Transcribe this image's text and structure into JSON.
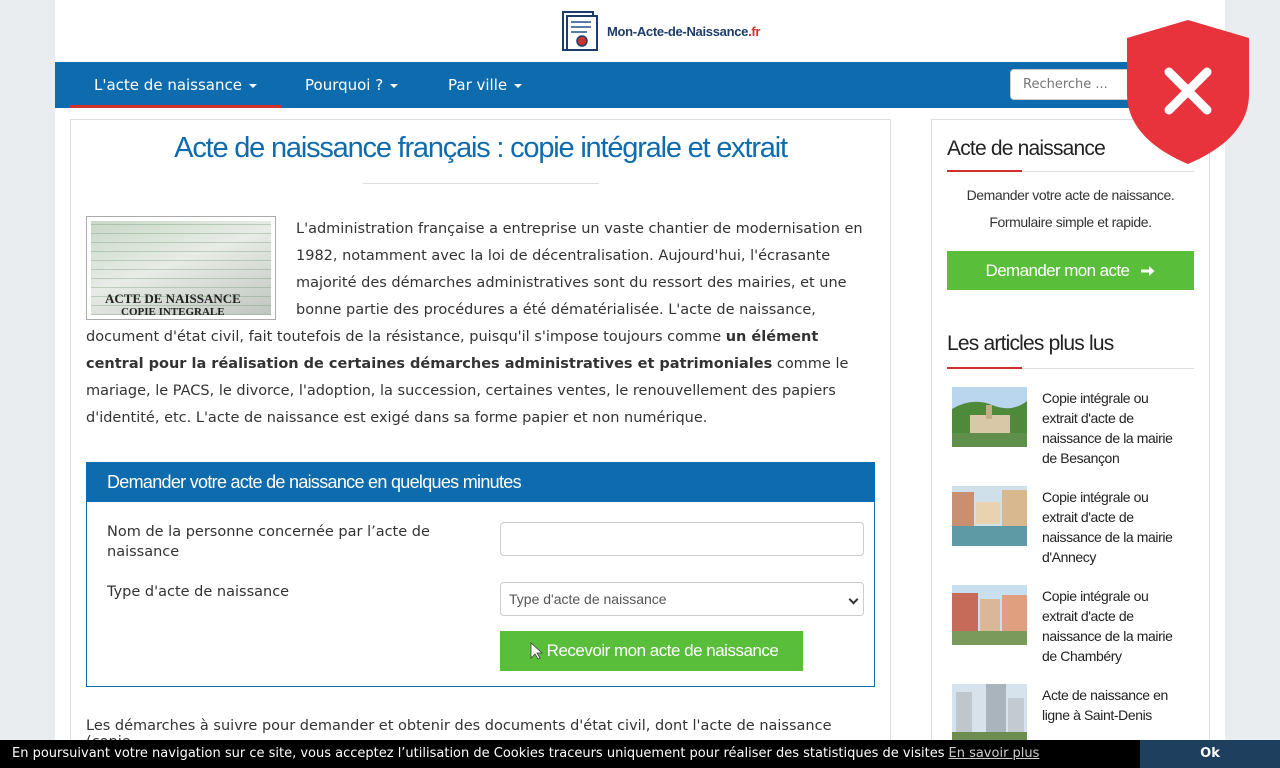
{
  "header": {
    "logo_text": "Mon-Acte-de-Naissance",
    "logo_tld": ".fr"
  },
  "nav": {
    "items": [
      {
        "label": "L'acte de naissance"
      },
      {
        "label": "Pourquoi ?"
      },
      {
        "label": "Par ville"
      }
    ],
    "search_placeholder": "Recherche ..."
  },
  "main": {
    "title": "Acte de naissance français : copie intégrale et extrait",
    "thumb_text_1": "ACTE DE NAISSANCE",
    "thumb_text_2": "COPIE INTEGRALE",
    "para_part1": "L'administration française a entreprise un vaste chantier de modernisation en 1982, notamment avec la loi de décentralisation. Aujourd'hui, l'écrasante majorité des démarches administratives sont du ressort des mairies, et une bonne partie des procédures a été dématérialisée. L'acte de naissance, document d'état civil, fait toutefois de la résistance, puisqu'il s'impose toujours comme ",
    "para_bold": "un élément central pour la réalisation de certaines démarches administratives et patrimoniales",
    "para_part2": " comme le mariage, le PACS, le divorce, l'adoption, la succession, certaines ventes, le renouvellement des papiers d'identité, etc. L'acte de naissance est exigé dans sa forme papier et non numérique.",
    "form": {
      "heading": "Demander votre acte de naissance en quelques minutes",
      "name_label": "Nom de la personne concernée par l’acte de naissance",
      "name_value": "",
      "type_label": "Type d'acte de naissance",
      "type_selected": "Type d'acte de naissance",
      "submit_label": "Recevoir mon acte de naissance"
    },
    "bottom_text": "Les démarches à suivre pour demander et obtenir des documents d'état civil, dont l'acte de naissance (copie"
  },
  "sidebar": {
    "box_title": "Acte de naissance",
    "box_desc_1": "Demander votre acte de naissance.",
    "box_desc_2": "Formulaire simple et rapide.",
    "box_button": "Demander mon acte",
    "articles_title": "Les articles plus lus",
    "articles": [
      {
        "title": "Copie intégrale ou extrait d'acte de naissance de la mairie de Besançon"
      },
      {
        "title": "Copie intégrale ou extrait d'acte de naissance de la mairie d'Annecy"
      },
      {
        "title": "Copie intégrale ou extrait d'acte de naissance de la mairie de Chambéry"
      },
      {
        "title": "Acte de naissance en ligne à Saint-Denis"
      }
    ]
  },
  "cookie_bar": {
    "text": "En poursuivant votre navigation sur ce site, vous acceptez l’utilisation de Cookies traceurs uniquement pour réaliser des statistiques de visites",
    "link": "En savoir plus",
    "ok": "Ok"
  },
  "colors": {
    "brand_blue": "#0e6bad",
    "accent_red": "#d0312d",
    "button_green": "#59be3a",
    "shield_red": "#e8323c"
  }
}
